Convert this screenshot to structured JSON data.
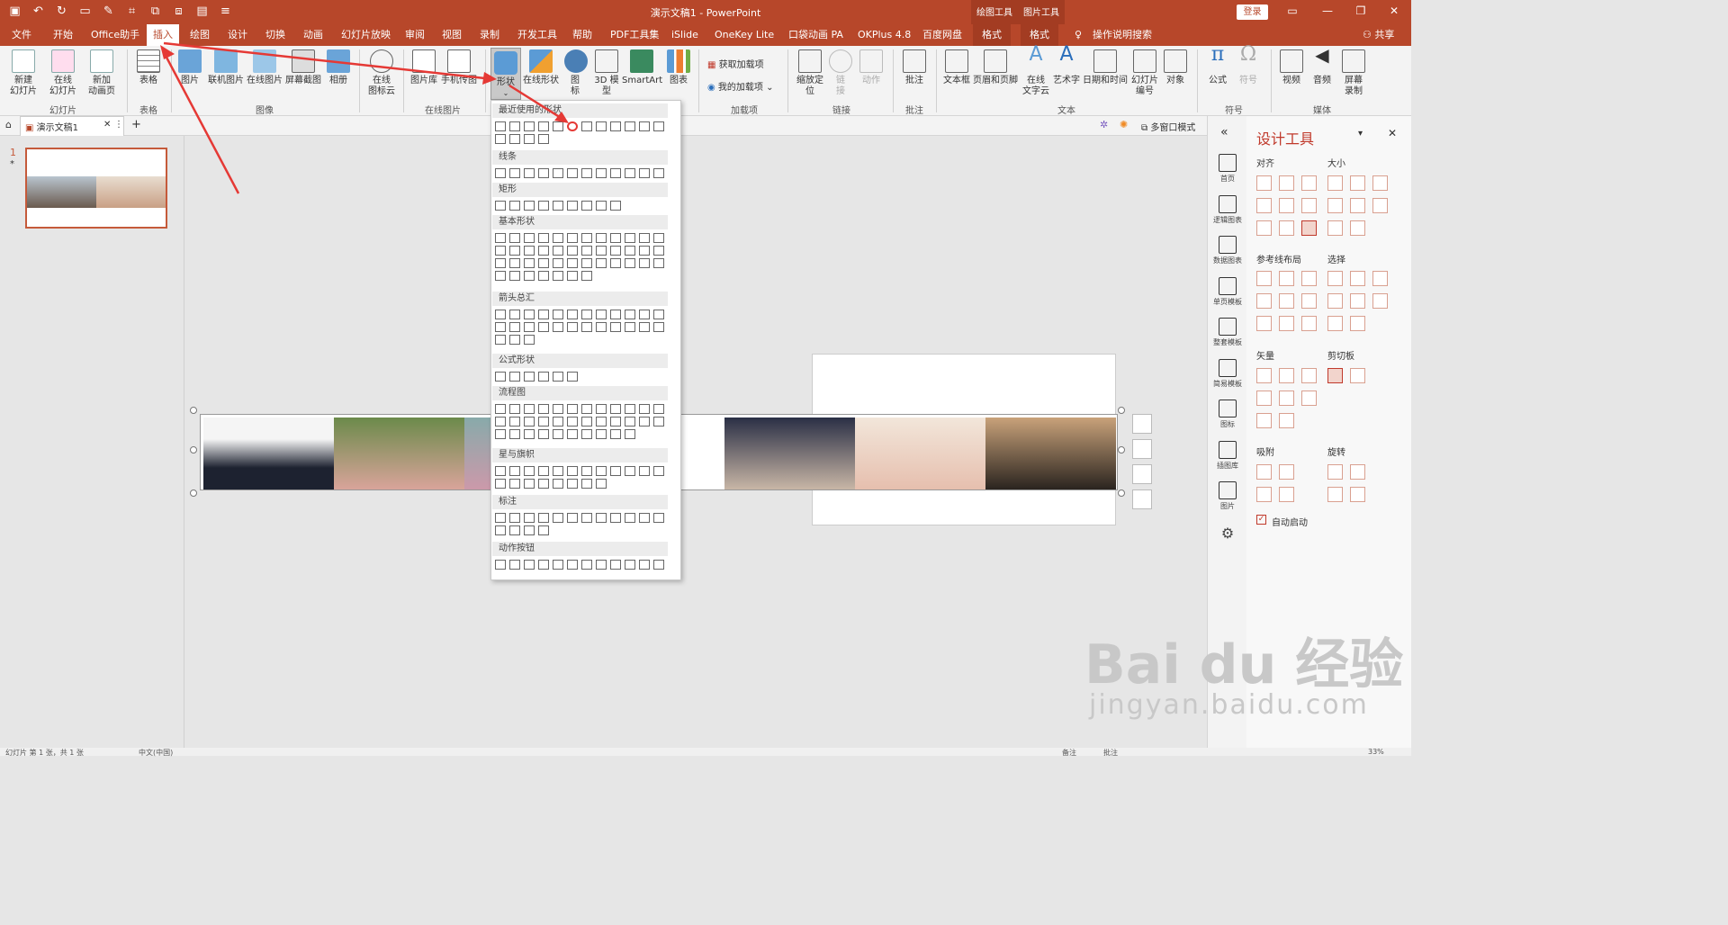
{
  "window": {
    "title": "演示文稿1 - PowerPoint",
    "context_headers": [
      "绘图工具",
      "图片工具"
    ],
    "login": "登录",
    "share": "共享"
  },
  "tabs": [
    "文件",
    "开始",
    "Office助手",
    "插入",
    "绘图",
    "设计",
    "切换",
    "动画",
    "幻灯片放映",
    "审阅",
    "视图",
    "录制",
    "开发工具",
    "帮助",
    "PDF工具集",
    "iSlide",
    "OneKey Lite",
    "口袋动画 PA",
    "OKPlus 4.8",
    "百度网盘",
    "格式",
    "格式"
  ],
  "tell_me": "操作说明搜索",
  "ribbon": {
    "buttons": [
      "新建\n幻灯片",
      "在线\n幻灯片",
      "新加\n动画页",
      "表格",
      "图片",
      "联机图片",
      "在线图片",
      "屏幕截图",
      "相册",
      "在线\n图标云",
      "图片库",
      "手机传图",
      "形状",
      "在线形状",
      "图\n标",
      "3D 模\n型",
      "SmartArt",
      "图表",
      "获取加载项",
      "我的加载项",
      "缩放定\n位",
      "链\n接",
      "动作",
      "批注",
      "文本框",
      "页眉和页脚",
      "在线\n文字云",
      "艺术字",
      "日期和时间",
      "幻灯片\n编号",
      "对象",
      "公式",
      "符号",
      "视频",
      "音频",
      "屏幕\n录制"
    ],
    "groups": [
      "幻灯片",
      "表格",
      "图像",
      "在线图片",
      "加载项",
      "链接",
      "批注",
      "文本",
      "符号",
      "媒体"
    ]
  },
  "doc_tab": {
    "name": "演示文稿1",
    "multi_window": "多窗口模式"
  },
  "thumb": {
    "number": "1",
    "star": "*"
  },
  "shapes_menu": {
    "sections": [
      "最近使用的形状",
      "线条",
      "矩形",
      "基本形状",
      "箭头总汇",
      "公式形状",
      "流程图",
      "星与旗帜",
      "标注",
      "动作按钮"
    ]
  },
  "rightbar": [
    "首页",
    "逻辑图表",
    "数据图表",
    "单页模板",
    "整套模板",
    "简易模板",
    "图标",
    "插图库",
    "图片"
  ],
  "design_panel": {
    "title": "设计工具",
    "sections": [
      "对齐",
      "大小",
      "参考线布局",
      "选择",
      "矢量",
      "剪切板",
      "吸附",
      "旋转"
    ],
    "autostart": "自动启动",
    "autostart_checked": true
  },
  "status": {
    "left": "幻灯片 第 1 张，共 1 张",
    "lang": "中文(中国)",
    "notes": "备注",
    "comments": "批注",
    "zoom": "33%"
  },
  "watermark": {
    "brand": "Bai du 经验",
    "url": "jingyan.baidu.com"
  },
  "colors": {
    "accent": "#b7472a",
    "arrow": "#e53935"
  }
}
